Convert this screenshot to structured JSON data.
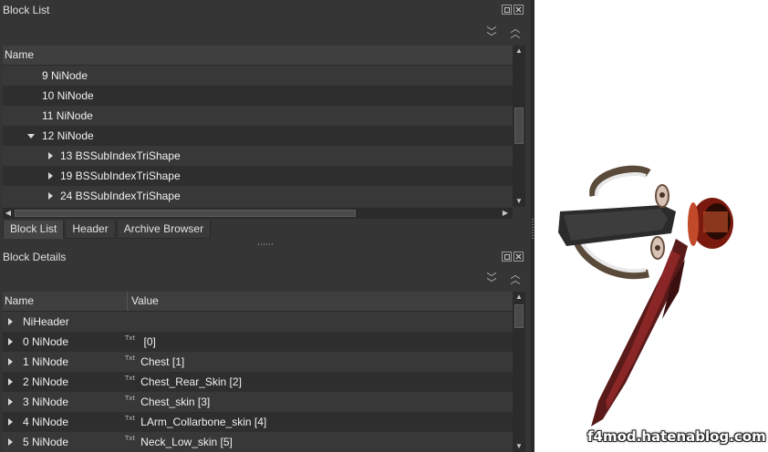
{
  "block_list": {
    "title": "Block List",
    "column_name": "Name",
    "rows": [
      {
        "label": "9 NiNode",
        "indent": 46,
        "arrow": "none"
      },
      {
        "label": "10 NiNode",
        "indent": 46,
        "arrow": "none"
      },
      {
        "label": "11 NiNode",
        "indent": 46,
        "arrow": "none"
      },
      {
        "label": "12 NiNode",
        "indent": 46,
        "arrow": "down"
      },
      {
        "label": "13 BSSubIndexTriShape",
        "indent": 66,
        "arrow": "right"
      },
      {
        "label": "19 BSSubIndexTriShape",
        "indent": 66,
        "arrow": "right"
      },
      {
        "label": "24 BSSubIndexTriShape",
        "indent": 66,
        "arrow": "right"
      }
    ]
  },
  "tabs": [
    "Block List",
    "Header",
    "Archive Browser"
  ],
  "block_details": {
    "title": "Block Details",
    "column_name": "Name",
    "column_value": "Value",
    "rows": [
      {
        "name": "NiHeader",
        "value": "",
        "icon": false
      },
      {
        "name": "0 NiNode",
        "value": " [0]",
        "icon": true
      },
      {
        "name": "1 NiNode",
        "value": "Chest [1]",
        "icon": true
      },
      {
        "name": "2 NiNode",
        "value": "Chest_Rear_Skin [2]",
        "icon": true
      },
      {
        "name": "3 NiNode",
        "value": "Chest_skin [3]",
        "icon": true
      },
      {
        "name": "4 NiNode",
        "value": "LArm_Collarbone_skin [4]",
        "icon": true
      },
      {
        "name": "5 NiNode",
        "value": "Neck_Low_skin [5]",
        "icon": true
      }
    ]
  },
  "txt_icon_label": "Txt",
  "icons": {
    "dock_float": "float-icon",
    "dock_close": "close-icon",
    "collapse_all": "chevrons-down-icon",
    "expand_all": "chevrons-up-icon"
  },
  "watermark": "f4mod.hatenablog.com",
  "colors": {
    "panel_bg": "#353535",
    "row_alt": "#2e2e2e",
    "viewport_bg": "#ffffff"
  }
}
